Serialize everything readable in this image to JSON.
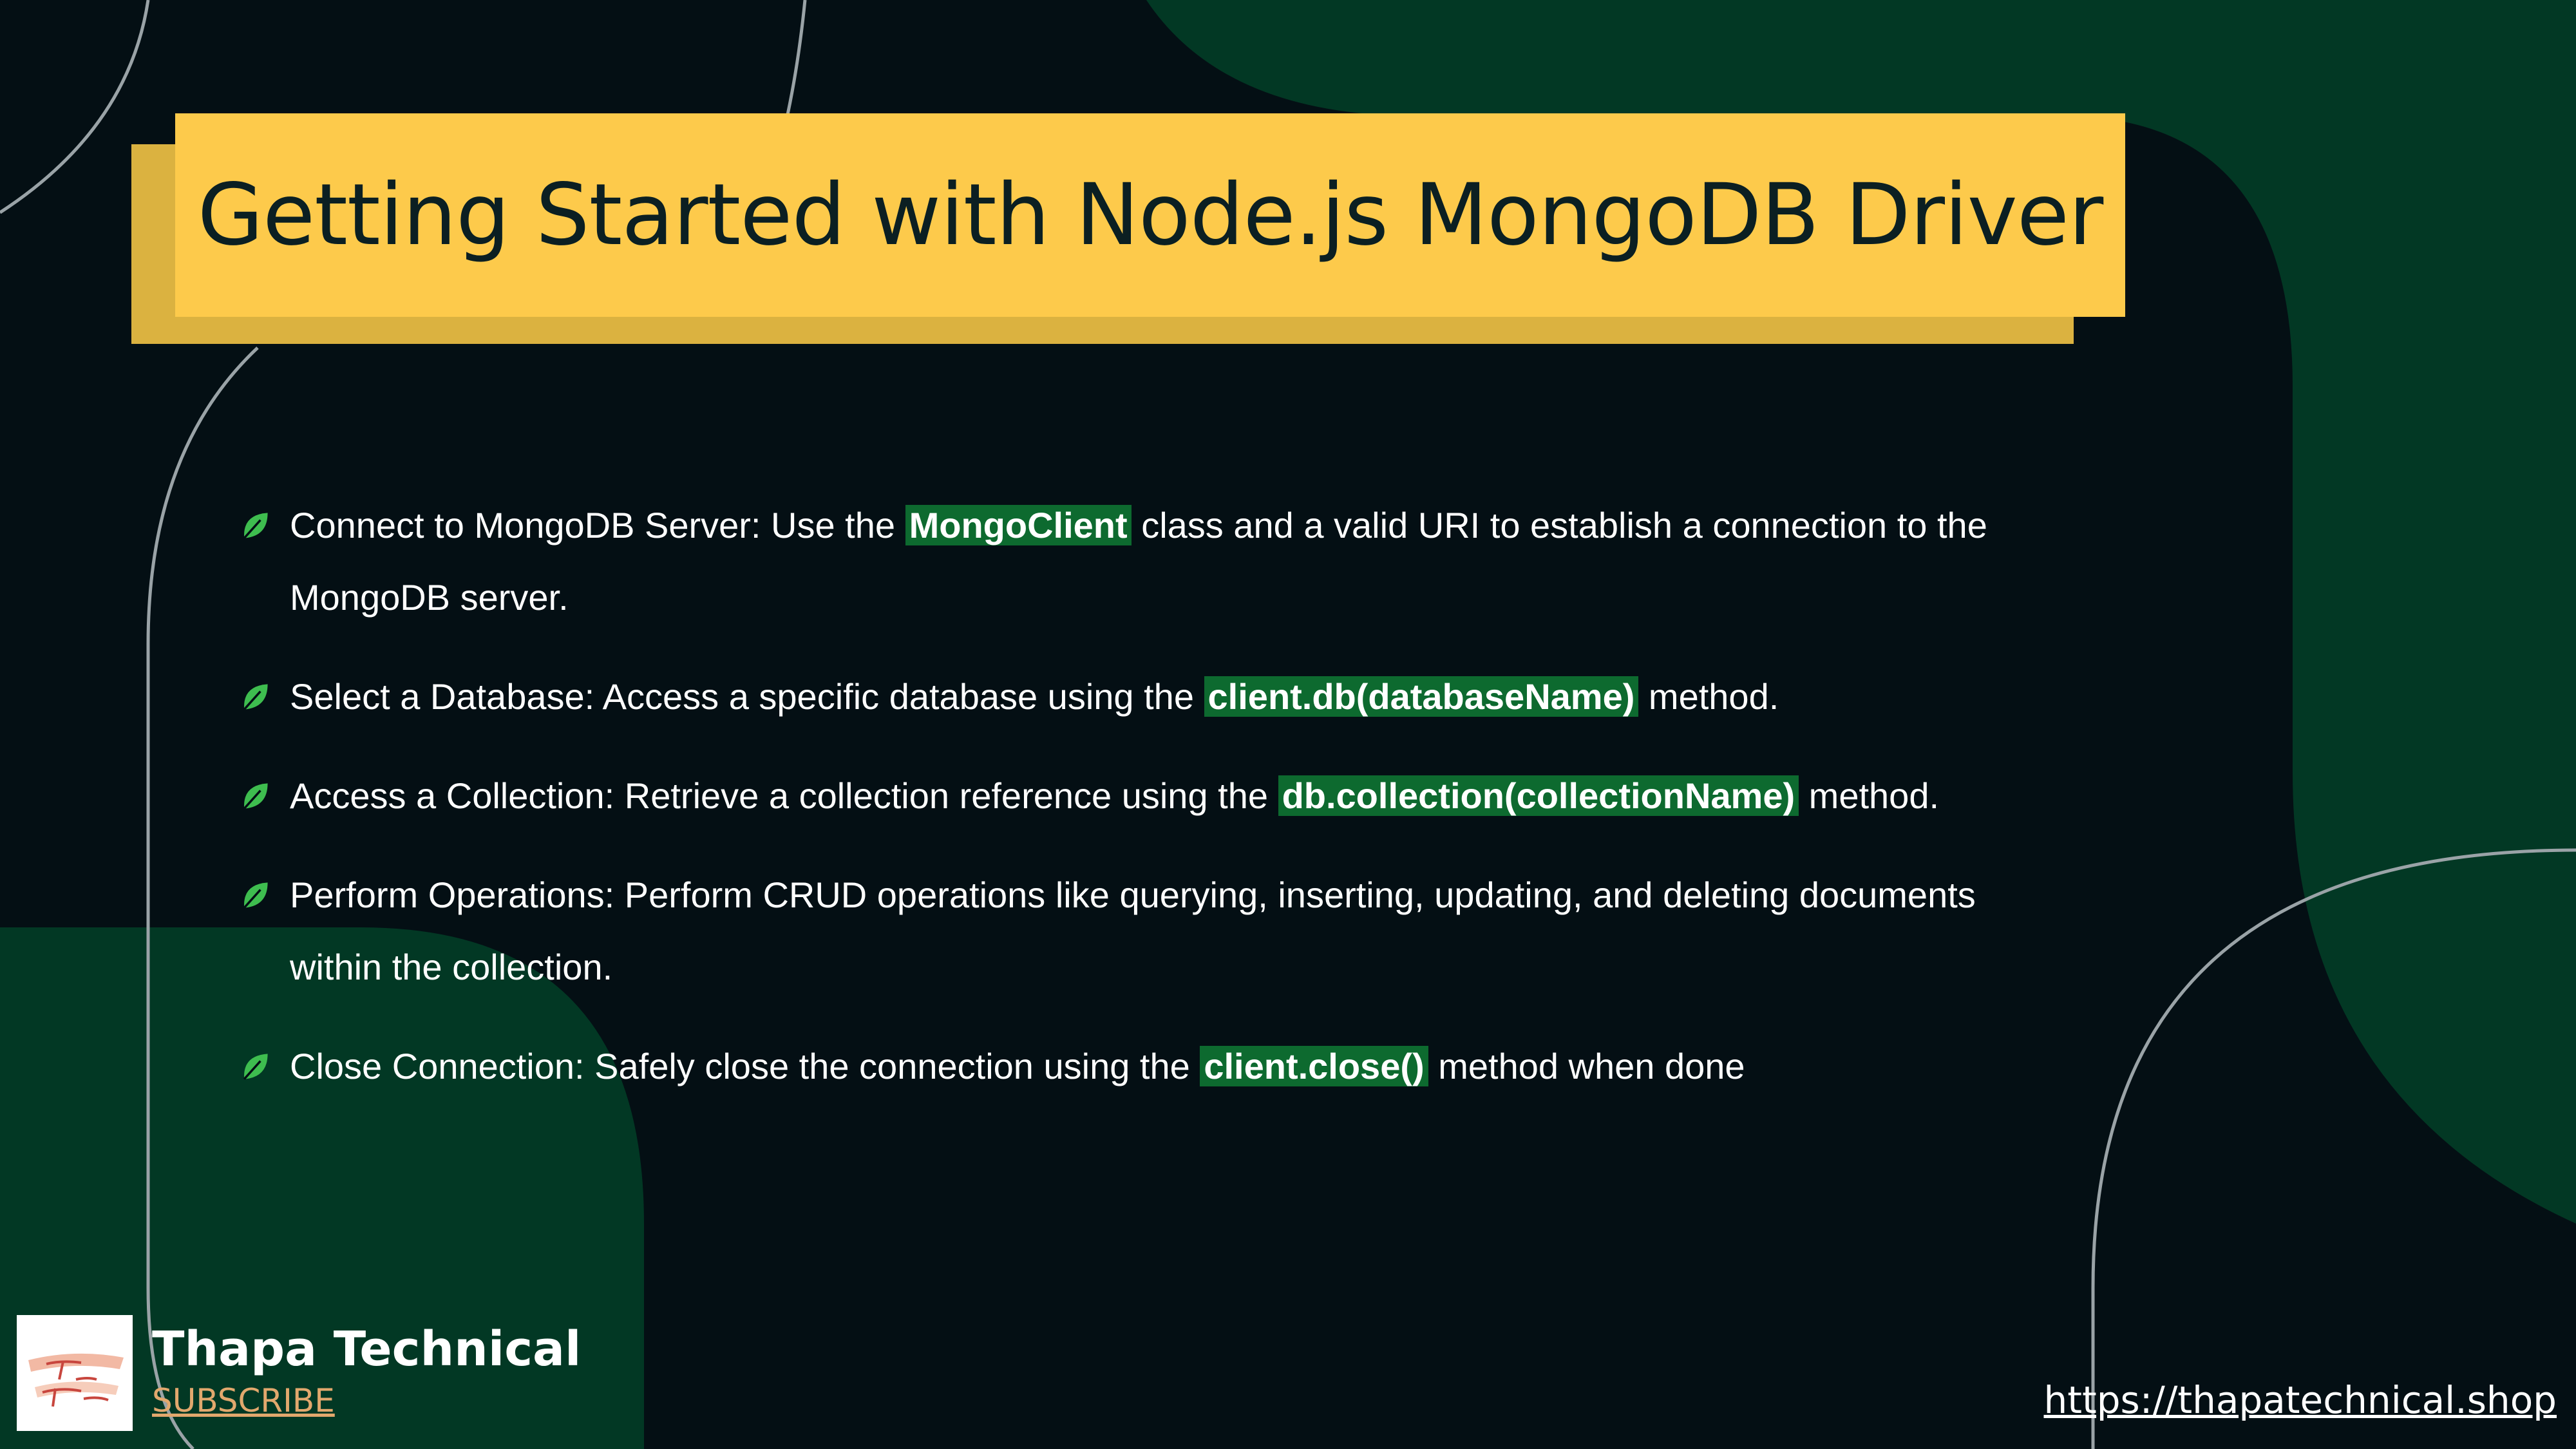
{
  "slide": {
    "title": "Getting Started with Node.js MongoDB Driver",
    "bullets": [
      {
        "before": "Connect to MongoDB Server: Use the ",
        "code": "MongoClient",
        "after": " class and a valid URI to establish a connection to the MongoDB server."
      },
      {
        "before": "Select a Database: Access a specific database using the ",
        "code": "client.db(databaseName)",
        "after": " method."
      },
      {
        "before": "Access a Collection: Retrieve a collection reference using the ",
        "code": "db.collection(collectionName)",
        "after": " method."
      },
      {
        "before": "Perform Operations: Perform CRUD operations like querying, inserting, updating, and deleting documents within the collection.",
        "code": "",
        "after": ""
      },
      {
        "before": "Close Connection: Safely close the connection using the ",
        "code": "client.close()",
        "after": " method when done"
      }
    ]
  },
  "brand": {
    "name": "Thapa Technical",
    "subscribe_label": "SUBSCRIBE",
    "url": "https://thapatechnical.shop"
  },
  "colors": {
    "background": "#040f14",
    "green_shape": "#023824",
    "title_bg": "#fdca4b",
    "title_shadow": "#dbb240",
    "code_highlight": "#0d6a2f",
    "leaf": "#3ebd4f",
    "subscribe": "#e2a86d"
  },
  "icons": {
    "bullet": "leaf-icon",
    "logo": "thapa-technical-logo"
  }
}
